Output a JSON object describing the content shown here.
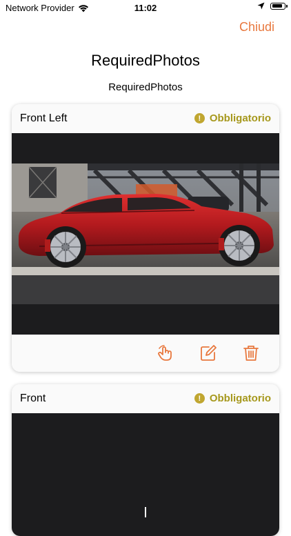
{
  "status_bar": {
    "carrier": "Network Provider",
    "time": "11:02",
    "battery_level": 0.9
  },
  "nav": {
    "close_label": "Chiudi"
  },
  "page": {
    "title": "RequiredPhotos",
    "subtitle": "RequiredPhotos"
  },
  "cards": [
    {
      "title": "Front Left",
      "badge": "Obbligatorio",
      "badge_icon": "!"
    },
    {
      "title": "Front",
      "badge": "Obbligatorio",
      "badge_icon": "!"
    }
  ],
  "colors": {
    "accent": "#e8783e",
    "required": "#a6981c",
    "photo_bg": "#1c1c1e"
  },
  "icons": {
    "wifi": "wifi-icon",
    "location": "location-arrow-icon",
    "touch": "touch-icon",
    "edit": "edit-icon",
    "delete": "trash-icon"
  }
}
